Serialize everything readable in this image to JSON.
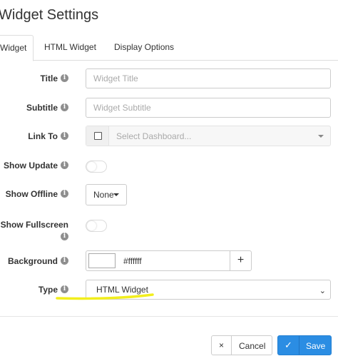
{
  "dialog": {
    "title": "Widget Settings"
  },
  "tabs": [
    {
      "label": "Widget",
      "active": true
    },
    {
      "label": "HTML Widget",
      "active": false
    },
    {
      "label": "Display Options",
      "active": false
    }
  ],
  "form": {
    "title": {
      "label": "Title",
      "placeholder": "Widget Title",
      "value": ""
    },
    "subtitle": {
      "label": "Subtitle",
      "placeholder": "Widget Subtitle",
      "value": ""
    },
    "link_to": {
      "label": "Link To",
      "placeholder": "Select Dashboard...",
      "checked": false
    },
    "show_update": {
      "label": "Show Update",
      "on": false
    },
    "show_offline": {
      "label": "Show Offline",
      "value": "None"
    },
    "show_fullscreen": {
      "label": "Show Fullscreen",
      "on": false
    },
    "background": {
      "label": "Background",
      "value": "#ffffff",
      "add_symbol": "+"
    },
    "type": {
      "label": "Type",
      "value": "HTML Widget"
    }
  },
  "info_glyph": "i",
  "footer": {
    "cancel_label": "Cancel",
    "cancel_icon": "×",
    "save_label": "Save",
    "save_icon": "✓"
  },
  "colors": {
    "accent": "#2b8de3",
    "highlight_marker": "#f2ee1d",
    "border": "#cccccc"
  }
}
